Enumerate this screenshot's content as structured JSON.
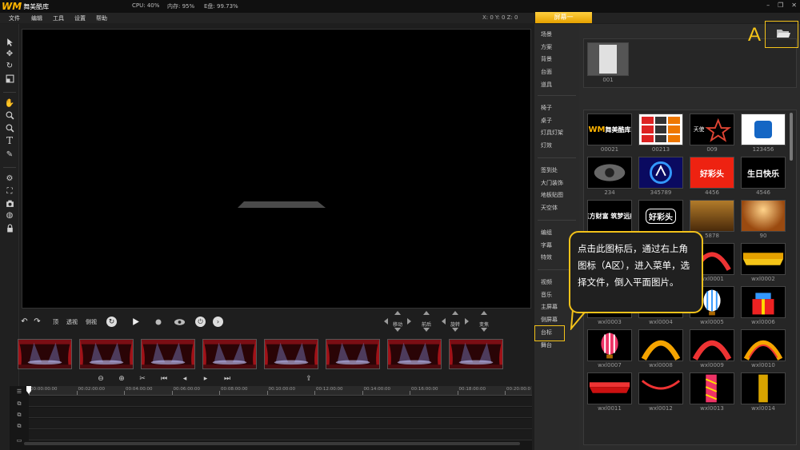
{
  "app": {
    "logo_mark": "WM",
    "logo_name": "舞美酷库",
    "cpu": "CPU: 40%",
    "memory": "内存: 95%",
    "disk": "E盘: 99.73%"
  },
  "menu": [
    "文件",
    "编辑",
    "工具",
    "设置",
    "帮助"
  ],
  "coords": "X: 0  Y: 0  Z: 0",
  "screen_tab": "屏幕一",
  "playback": {
    "labels": [
      "顶",
      "透视",
      "侧视"
    ]
  },
  "pads": [
    "移动",
    "前后",
    "旋转",
    "变焦"
  ],
  "timeline": {
    "ticks": [
      "00:00:00:00",
      "00:02:00:00",
      "00:04:00:00",
      "00:06:00:00",
      "00:08:00:00",
      "00:10:00:00",
      "00:12:00:00",
      "00:14:00:00",
      "00:16:00:00",
      "00:18:00:00",
      "00:20:00:0"
    ]
  },
  "categories": {
    "group1": [
      "场景",
      "方案",
      "背景",
      "台面",
      "道具"
    ],
    "group2": [
      "椅子",
      "桌子",
      "灯具灯架",
      "灯效"
    ],
    "group3": [
      "签到处",
      "大门装饰",
      "地板贴图",
      "天空体"
    ],
    "group4": [
      "编组",
      "字幕",
      "特效"
    ],
    "group5": [
      "视频",
      "音乐",
      "主屏幕",
      "侧屏幕",
      "台标",
      "舞台"
    ]
  },
  "top_asset": {
    "label": "001"
  },
  "assets": [
    {
      "label": "00021",
      "text": "WM舞美酷库"
    },
    {
      "label": "00213",
      "text": "logos"
    },
    {
      "label": "009",
      "text": "天使"
    },
    {
      "label": "123456",
      "text": "大连"
    },
    {
      "label": "234",
      "text": ""
    },
    {
      "label": "345789",
      "text": ""
    },
    {
      "label": "4456",
      "text": "好彩头"
    },
    {
      "label": "4546",
      "text": "生日快乐"
    },
    {
      "label": "",
      "text": "东方财富 筑梦远航"
    },
    {
      "label": "",
      "text": "好彩头"
    },
    {
      "label": "5878",
      "text": ""
    },
    {
      "label": "90",
      "text": ""
    },
    {
      "label": "",
      "text": ""
    },
    {
      "label": "",
      "text": ""
    },
    {
      "label": "wxl0001",
      "text": ""
    },
    {
      "label": "wxl0002",
      "text": ""
    },
    {
      "label": "wxl0003",
      "text": ""
    },
    {
      "label": "wxl0004",
      "text": ""
    },
    {
      "label": "wxl0005",
      "text": ""
    },
    {
      "label": "wxl0006",
      "text": ""
    },
    {
      "label": "wxl0007",
      "text": ""
    },
    {
      "label": "wxl0008",
      "text": ""
    },
    {
      "label": "wxl0009",
      "text": ""
    },
    {
      "label": "wxl0010",
      "text": ""
    },
    {
      "label": "wxl0011",
      "text": ""
    },
    {
      "label": "wxl0012",
      "text": ""
    },
    {
      "label": "wxl0013",
      "text": ""
    },
    {
      "label": "wxl0014",
      "text": ""
    }
  ],
  "annotation": {
    "letter": "A",
    "callout": "点击此图标后，通过右上角图标（A区），进入菜单，选择文件，倒入平面图片。"
  },
  "colors": {
    "accent": "#f3c21a",
    "tab": "#f0b000"
  }
}
